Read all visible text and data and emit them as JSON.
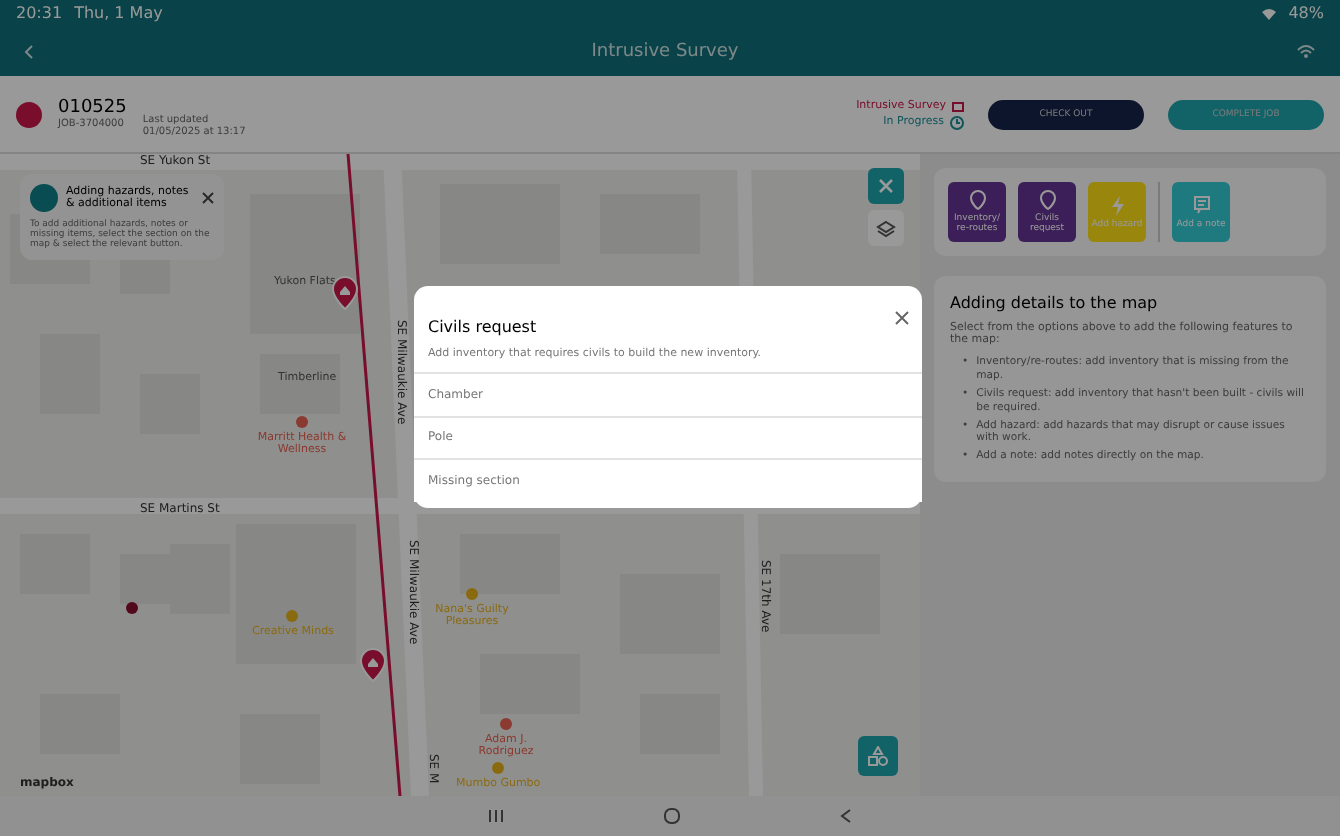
{
  "status_bar": {
    "time": "20:31",
    "date": "Thu, 1 May",
    "battery": "48%"
  },
  "header": {
    "title": "Intrusive Survey"
  },
  "job": {
    "number": "010525",
    "job_id": "JOB-3704000",
    "updated_label": "Last updated",
    "updated_value": "01/05/2025 at 13:17",
    "type": "Intrusive Survey",
    "status": "In Progress"
  },
  "actions": [
    {
      "label": "CHECK OUT",
      "kind": "dark"
    },
    {
      "label": "COMPLETE JOB",
      "kind": "teal"
    }
  ],
  "map": {
    "labels": [
      {
        "text": "SE Yukon St",
        "kind": "street"
      },
      {
        "text": "Yukon Flats",
        "kind": "place"
      },
      {
        "text": "Timberline",
        "kind": "place"
      },
      {
        "text": "Marritt Health & Wellness",
        "kind": "poi",
        "color": "#8a3a30"
      },
      {
        "text": "SE Martins St",
        "kind": "street"
      },
      {
        "text": "SE Milwaukie Ave",
        "kind": "vstreet"
      },
      {
        "text": "SE Milwaukie Ave",
        "kind": "vstreet"
      },
      {
        "text": "Creative Minds",
        "kind": "poi",
        "color": "#8a6a10"
      },
      {
        "text": "Nana's Guilty Pleasures",
        "kind": "poi",
        "color": "#8a6a10"
      },
      {
        "text": "SE 17th Ave",
        "kind": "vstreet"
      },
      {
        "text": "Adam J. Rodriguez",
        "kind": "poi",
        "color": "#8a3a30"
      },
      {
        "text": "SE M",
        "kind": "vstreet"
      },
      {
        "text": "mapbox",
        "kind": "logo"
      },
      {
        "text": "Mumbo Gumbo",
        "kind": "poi",
        "color": "#8a6a10"
      }
    ]
  },
  "tooltip": {
    "title": "Adding hazards, notes & additional items",
    "body": "To add additional hazards, notes or missing items, select the section on the map & select the relevant button."
  },
  "tools": [
    {
      "label": "Inventory/ re-routes",
      "kind": "pin",
      "color": "#3c1f58"
    },
    {
      "label": "Civils request",
      "kind": "pin",
      "color": "#3c1f58"
    },
    {
      "label": "Add hazard",
      "kind": "bolt",
      "color": "#98860e"
    },
    {
      "label": "Add a note",
      "kind": "note",
      "color": "#1f7a80"
    }
  ],
  "info": {
    "title": "Adding details to the map",
    "intro": "Select from the options above to add the following features to the map:",
    "bullets": [
      {
        "marker": "•",
        "text": "Inventory/re-routes: add inventory that is missing from the map."
      },
      {
        "marker": "•",
        "text": "Civils request: add inventory that hasn't been built - civils will be required."
      },
      {
        "marker": "•",
        "text": "Add hazard: add hazards that may disrupt or cause issues with work."
      },
      {
        "marker": "•",
        "text": "Add a note: add notes directly on the map."
      }
    ]
  },
  "modal": {
    "title": "Civils request",
    "subtitle": "Add inventory that requires civils to build the new inventory.",
    "options": [
      "Chamber",
      "Pole",
      "Missing section"
    ]
  }
}
